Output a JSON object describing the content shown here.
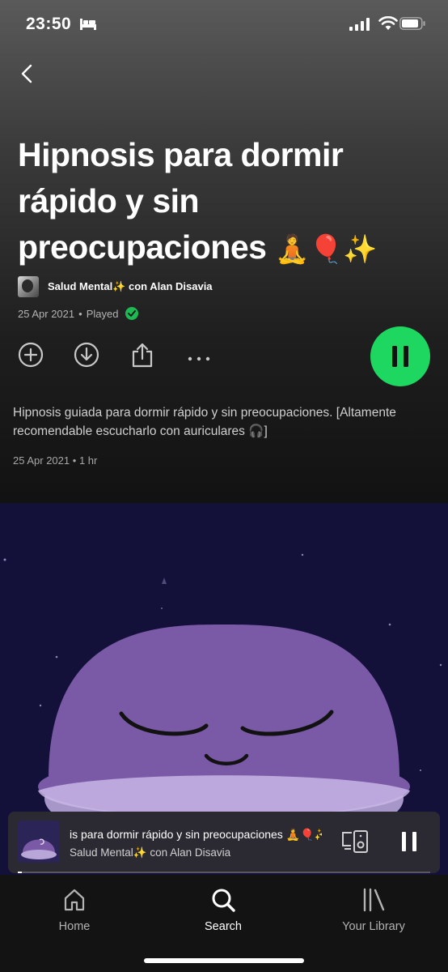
{
  "status_bar": {
    "time": "23:50",
    "icons": [
      "bed-icon",
      "signal-icon",
      "wifi-icon",
      "battery-icon"
    ]
  },
  "nav": {
    "back_icon": "chevron-left-icon"
  },
  "episode": {
    "title": "Hipnosis para dormir rápido y sin preocupaciones",
    "title_emoji": "🧘🎈✨",
    "show_name": "Salud Mental✨ con Alan Disavia",
    "date": "25 Apr 2021",
    "separator": "•",
    "status": "Played",
    "description": "Hipnosis guiada para dormir rápido y sin preocupaciones. [Altamente recomendable escucharlo con auriculares 🎧]",
    "date2": "25 Apr 2021",
    "duration": "1 hr"
  },
  "actions": {
    "icons": [
      "add-icon",
      "download-icon",
      "share-icon",
      "more-icon"
    ],
    "play_state": "pause-icon"
  },
  "mini_player": {
    "title": "is para dormir rápido y sin preocupaciones 🧘🎈✨",
    "subtitle": "Salud Mental✨ con Alan Disavia",
    "progress": 0.01,
    "icons": [
      "connect-device-icon",
      "pause-icon"
    ]
  },
  "tabs": [
    {
      "label": "Home",
      "icon": "home-icon",
      "active": false
    },
    {
      "label": "Search",
      "icon": "search-icon",
      "active": true
    },
    {
      "label": "Your Library",
      "icon": "library-icon",
      "active": false
    }
  ],
  "colors": {
    "accent_green": "#1ed760",
    "played_green": "#1db954",
    "background": "#121212",
    "artwork_bg": "#13103a",
    "character_purple": "#7a5aa6"
  }
}
